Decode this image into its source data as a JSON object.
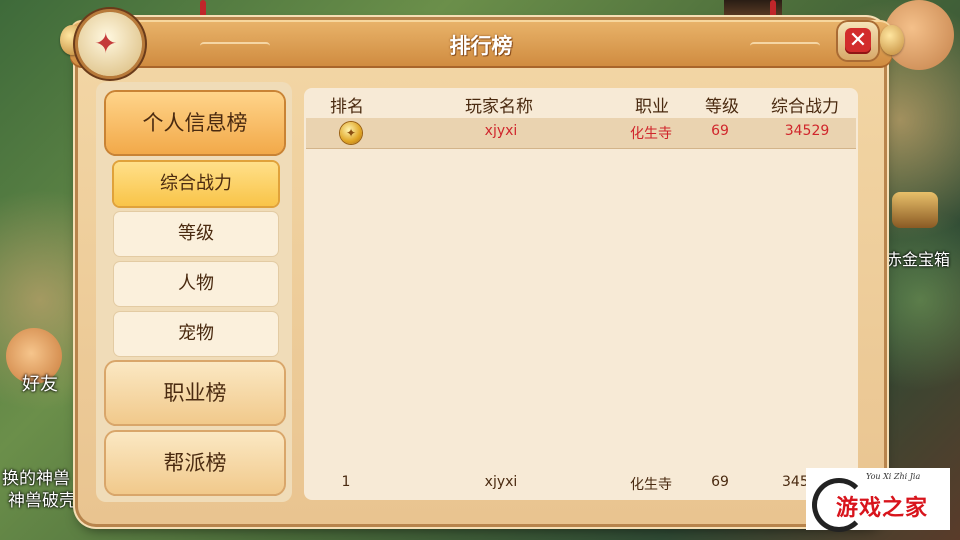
{
  "window": {
    "title": "排行榜"
  },
  "background": {
    "left_labels": [
      "好友",
      "换的神兽",
      "神兽破壳"
    ],
    "right_labels": [
      "赤金宝箱"
    ]
  },
  "categories": [
    {
      "label": "个人信息榜",
      "active": true,
      "sub_items": [
        {
          "label": "综合战力",
          "active": true
        },
        {
          "label": "等级",
          "active": false
        },
        {
          "label": "人物",
          "active": false
        },
        {
          "label": "宠物",
          "active": false
        }
      ]
    },
    {
      "label": "职业榜",
      "active": false
    },
    {
      "label": "帮派榜",
      "active": false
    }
  ],
  "table": {
    "headers": [
      "排名",
      "玩家名称",
      "职业",
      "等级",
      "综合战力"
    ],
    "rows": [
      {
        "rank_icon": "gold-medal-icon",
        "name": "xjyxi",
        "job": "化生寺",
        "level": "69",
        "power": "34529"
      }
    ],
    "my_row": {
      "rank": "1",
      "name": "xjyxi",
      "job": "化生寺",
      "level": "69",
      "power": "345"
    }
  },
  "watermark": {
    "text": "游戏之家",
    "sub": "You Xi Zhi Jia"
  },
  "colors": {
    "accent": "#f2a949",
    "highlight_text": "#d0262c",
    "frame": "#e9c490"
  }
}
